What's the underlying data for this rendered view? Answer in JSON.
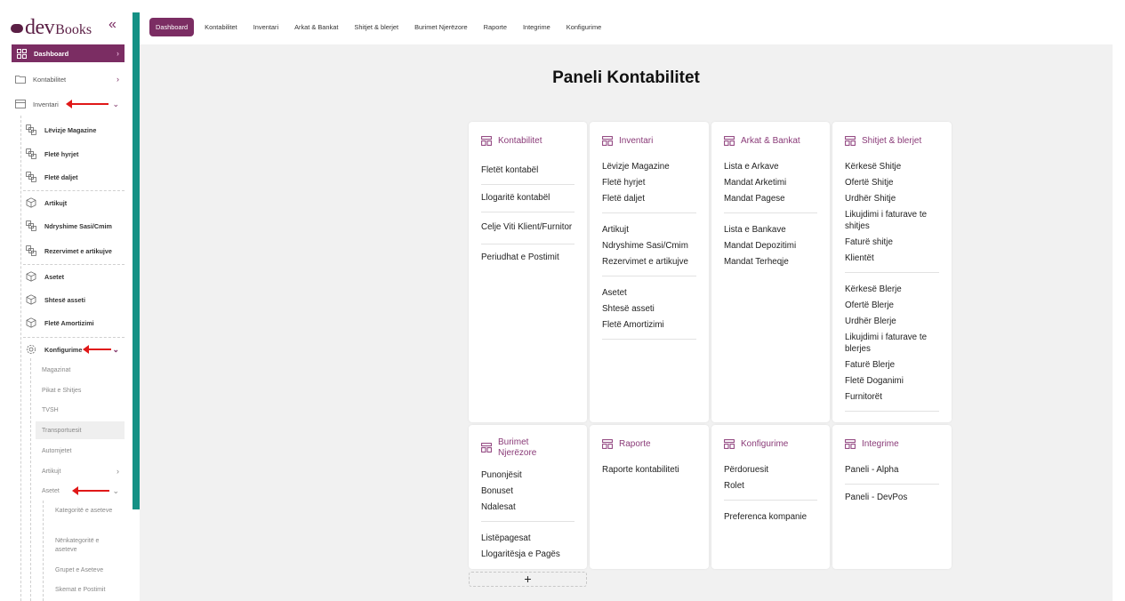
{
  "brand": {
    "name_dev": "dev",
    "name_books": "Books"
  },
  "sidebar": {
    "collapse": "«",
    "dashboard": "Dashboard",
    "kontabilitet": "Kontabilitet",
    "inventari": "Inventari",
    "inventari_items": [
      "Lëvizje Magazine",
      "Fletë hyrjet",
      "Fletë daljet",
      "Artikujt",
      "Ndryshime Sasi/Cmim",
      "Rezervimet e artikujve",
      "Asetet",
      "Shtesë asseti",
      "Fletë Amortizimi"
    ],
    "konfigurime": "Konfigurime",
    "konfigurime_items": [
      "Magazinat",
      "Pikat e Shitjes",
      "TVSH",
      "Transportuesit",
      "Automjetet",
      "Artikujt",
      "Asetet"
    ],
    "asetet_items": [
      "Kategoritë e aseteve",
      "Nënkategoritë e aseteve",
      "Grupet e Aseteve",
      "Skemat e Postimit"
    ]
  },
  "topnav": [
    "Dashboard",
    "Kontabilitet",
    "Inventari",
    "Arkat & Bankat",
    "Shitjet & blerjet",
    "Burimet Njerëzore",
    "Raporte",
    "Integrime",
    "Konfigurime"
  ],
  "page_title": "Paneli Kontabilitet",
  "cards": {
    "kontabilitet": {
      "title": "Kontabilitet",
      "items": [
        "Fletët kontabël",
        "Llogaritë kontabël",
        "Celje Viti Klient/Furnitor",
        "Periudhat e Postimit"
      ]
    },
    "inventari": {
      "title": "Inventari",
      "group1": [
        "Lëvizje Magazine",
        "Fletë hyrjet",
        "Fletë daljet"
      ],
      "group2": [
        "Artikujt",
        "Ndryshime Sasi/Cmim",
        "Rezervimet e artikujve"
      ],
      "group3": [
        "Asetet",
        "Shtesë asseti",
        "Fletë Amortizimi"
      ]
    },
    "arkat": {
      "title": "Arkat & Bankat",
      "group1": [
        "Lista e Arkave",
        "Mandat Arketimi",
        "Mandat Pagese"
      ],
      "group2": [
        "Lista e Bankave",
        "Mandat Depozitimi",
        "Mandat Terheqje"
      ]
    },
    "shitjet": {
      "title": "Shitjet & blerjet",
      "group1": [
        "Kërkesë Shitje",
        "Ofertë Shitje",
        "Urdhër Shitje",
        "Likujdimi i faturave te shitjes",
        "Faturë shitje",
        "Klientët"
      ],
      "group2": [
        "Kërkesë Blerje",
        "Ofertë Blerje",
        "Urdhër Blerje",
        "Likujdimi i faturave te blerjes",
        "Faturë Blerje",
        "Fletë Doganimi",
        "Furnitorët"
      ]
    },
    "burimet": {
      "title": "Burimet Njerëzore",
      "group1": [
        "Punonjësit",
        "Bonuset",
        "Ndalesat"
      ],
      "group2": [
        "Listëpagesat",
        "Llogaritësja e Pagës"
      ]
    },
    "raporte": {
      "title": "Raporte",
      "items": [
        "Raporte kontabiliteti"
      ]
    },
    "konfigurime": {
      "title": "Konfigurime",
      "group1": [
        "Përdoruesit",
        "Rolet"
      ],
      "group2": [
        "Preferenca kompanie"
      ]
    },
    "integrime": {
      "title": "Integrime",
      "items": [
        "Paneli - Alpha",
        "Paneli - DevPos"
      ]
    }
  },
  "add_card": "+"
}
